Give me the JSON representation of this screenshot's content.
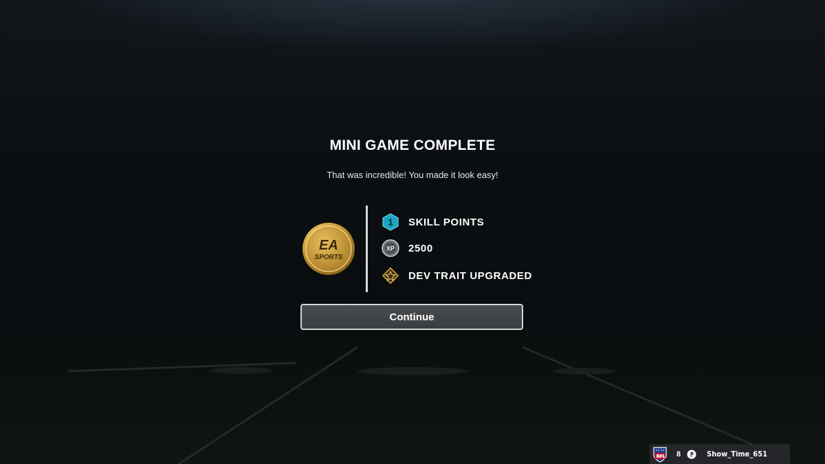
{
  "dialog": {
    "title": "MINI GAME COMPLETE",
    "message": "That was incredible! You made it look easy!"
  },
  "coin": {
    "icon": "ea-sports-coin-icon",
    "line1": "EA",
    "line2": "SPORTS"
  },
  "rewards": [
    {
      "icon": "skill-point-hex-icon",
      "icon_text": "1",
      "label": "SKILL POINTS",
      "color": "#1aa6c4"
    },
    {
      "icon": "xp-coin-icon",
      "icon_text": "XP",
      "label": "2500",
      "color": "#9aa0a6"
    },
    {
      "icon": "dev-trait-diamond-icon",
      "icon_text": "",
      "label": "DEV TRAIT UPGRADED",
      "color": "#b8893a"
    }
  ],
  "continue_button": {
    "label": "Continue"
  },
  "user": {
    "league_icon": "nfl-shield-icon",
    "level": "8",
    "platform_icon": "playstation-icon",
    "gamertag": "Show_Time_651"
  },
  "colors": {
    "background": "#090b0d",
    "accent_gold": "#c99a3a",
    "skill_teal": "#1aa6c4"
  }
}
